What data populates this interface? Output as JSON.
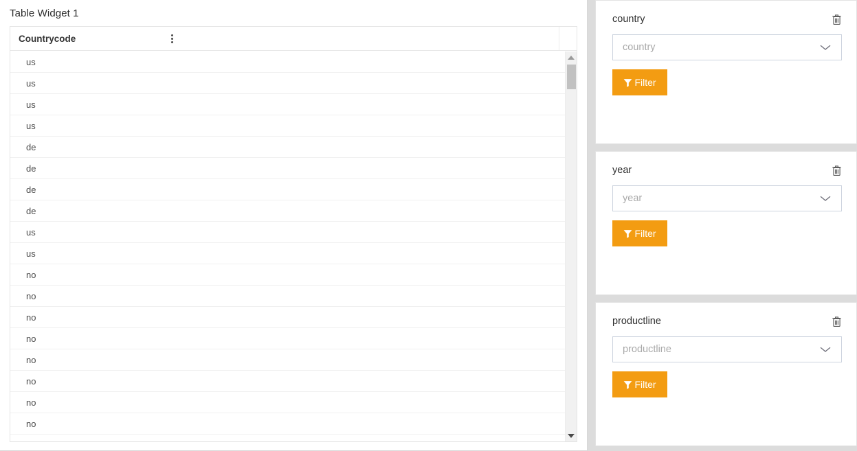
{
  "theme": {
    "page_background": "#dcdcdc",
    "panel_background": "#ffffff",
    "accent": "#f39c12",
    "text": "#2e2e2e",
    "muted_text": "#a9a9a9",
    "border": "#e2e2e2",
    "scrollbar_track": "#f1f1f1",
    "scrollbar_thumb": "#c1c1c1"
  },
  "table_widget": {
    "title": "Table Widget 1",
    "menu_icon": "kebab-menu-icon",
    "columns": [
      {
        "label": "Countrycode"
      }
    ],
    "rows": [
      {
        "countrycode": "us"
      },
      {
        "countrycode": "us"
      },
      {
        "countrycode": "us"
      },
      {
        "countrycode": "us"
      },
      {
        "countrycode": "de"
      },
      {
        "countrycode": "de"
      },
      {
        "countrycode": "de"
      },
      {
        "countrycode": "de"
      },
      {
        "countrycode": "us"
      },
      {
        "countrycode": "us"
      },
      {
        "countrycode": "no"
      },
      {
        "countrycode": "no"
      },
      {
        "countrycode": "no"
      },
      {
        "countrycode": "no"
      },
      {
        "countrycode": "no"
      },
      {
        "countrycode": "no"
      },
      {
        "countrycode": "no"
      },
      {
        "countrycode": "no"
      },
      {
        "countrycode": ""
      }
    ],
    "scrollbar": {
      "up_icon": "scroll-up-arrow-icon",
      "down_icon": "scroll-down-arrow-icon",
      "thumb": "scrollbar-thumb"
    }
  },
  "filter_panels": [
    {
      "title": "country",
      "delete_icon": "trash-icon",
      "select": {
        "placeholder": "country",
        "value": "",
        "chevron_icon": "chevron-down-icon"
      },
      "button": {
        "label": "Filter",
        "icon": "funnel-icon"
      }
    },
    {
      "title": "year",
      "delete_icon": "trash-icon",
      "select": {
        "placeholder": "year",
        "value": "",
        "chevron_icon": "chevron-down-icon"
      },
      "button": {
        "label": "Filter",
        "icon": "funnel-icon"
      }
    },
    {
      "title": "productline",
      "delete_icon": "trash-icon",
      "select": {
        "placeholder": "productline",
        "value": "",
        "chevron_icon": "chevron-down-icon"
      },
      "button": {
        "label": "Filter",
        "icon": "funnel-icon"
      }
    }
  ]
}
